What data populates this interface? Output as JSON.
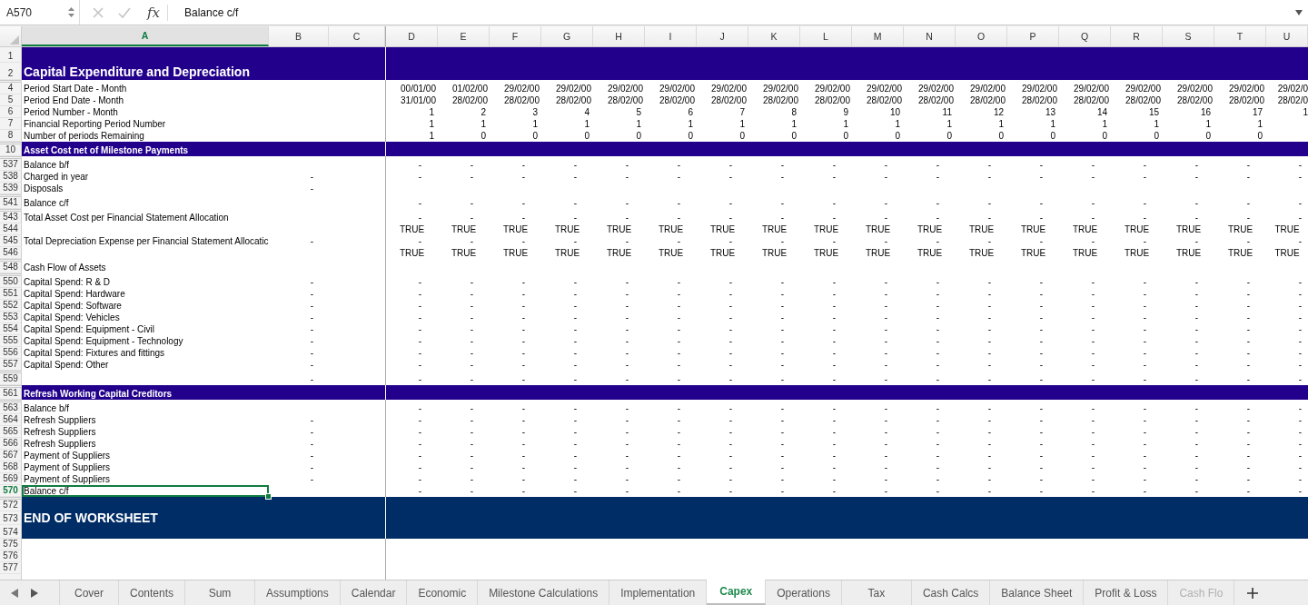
{
  "formula_bar": {
    "name_box": "A570",
    "function_label": "fx",
    "formula": "Balance c/f"
  },
  "columns": [
    {
      "label": "A",
      "selected": true
    },
    {
      "label": "B",
      "selected": false
    },
    {
      "label": "C",
      "selected": false
    },
    {
      "label": "D",
      "selected": false
    },
    {
      "label": "E",
      "selected": false
    },
    {
      "label": "F",
      "selected": false
    },
    {
      "label": "G",
      "selected": false
    },
    {
      "label": "H",
      "selected": false
    },
    {
      "label": "I",
      "selected": false
    },
    {
      "label": "J",
      "selected": false
    },
    {
      "label": "K",
      "selected": false
    },
    {
      "label": "L",
      "selected": false
    },
    {
      "label": "M",
      "selected": false
    },
    {
      "label": "N",
      "selected": false
    },
    {
      "label": "O",
      "selected": false
    },
    {
      "label": "P",
      "selected": false
    },
    {
      "label": "Q",
      "selected": false
    },
    {
      "label": "R",
      "selected": false
    },
    {
      "label": "S",
      "selected": false
    },
    {
      "label": "T",
      "selected": false
    },
    {
      "label": "U",
      "selected": false
    }
  ],
  "rows": [
    {
      "number": "1",
      "kind": "title",
      "selected": false
    },
    {
      "number": "2",
      "kind": "title",
      "label": "Capital Expenditure and Depreciation",
      "selected": false
    },
    {
      "number": "4",
      "kind": "date",
      "label": "Period Start Date - Month",
      "selected": false,
      "values": [
        "00/01/00",
        "01/02/00",
        "29/02/00",
        "29/02/00",
        "29/02/00",
        "29/02/00",
        "29/02/00",
        "29/02/00",
        "29/02/00",
        "29/02/00",
        "29/02/00",
        "29/02/00",
        "29/02/00",
        "29/02/00",
        "29/02/00",
        "29/02/00",
        "29/02/00",
        "29/02/0"
      ]
    },
    {
      "number": "5",
      "kind": "date",
      "label": "Period End Date - Month",
      "selected": false,
      "values": [
        "31/01/00",
        "28/02/00",
        "28/02/00",
        "28/02/00",
        "28/02/00",
        "28/02/00",
        "28/02/00",
        "28/02/00",
        "28/02/00",
        "28/02/00",
        "28/02/00",
        "28/02/00",
        "28/02/00",
        "28/02/00",
        "28/02/00",
        "28/02/00",
        "28/02/00",
        "28/02/0"
      ]
    },
    {
      "number": "6",
      "kind": "number",
      "label": "Period Number - Month",
      "selected": false,
      "values": [
        "1",
        "2",
        "3",
        "4",
        "5",
        "6",
        "7",
        "8",
        "9",
        "10",
        "11",
        "12",
        "13",
        "14",
        "15",
        "16",
        "17",
        "1"
      ]
    },
    {
      "number": "7",
      "kind": "number",
      "label": "Financial Reporting Period Number",
      "selected": false,
      "values": [
        "1",
        "1",
        "1",
        "1",
        "1",
        "1",
        "1",
        "1",
        "1",
        "1",
        "1",
        "1",
        "1",
        "1",
        "1",
        "1",
        "1"
      ]
    },
    {
      "number": "8",
      "kind": "number",
      "label": "Number of periods Remaining",
      "selected": false,
      "values": [
        "1",
        "0",
        "0",
        "0",
        "0",
        "0",
        "0",
        "0",
        "0",
        "0",
        "0",
        "0",
        "0",
        "0",
        "0",
        "0",
        "0"
      ]
    },
    {
      "number": "10",
      "kind": "section",
      "label": "Asset Cost net of Milestone Payments",
      "selected": false
    },
    {
      "number": "537",
      "kind": "accounting",
      "label": "Balance b/f",
      "selected": false,
      "values": [
        "-",
        "-",
        "-",
        "-",
        "-",
        "-",
        "-",
        "-",
        "-",
        "-",
        "-",
        "-",
        "-",
        "-",
        "-",
        "-",
        "-",
        "-"
      ]
    },
    {
      "number": "538",
      "kind": "accounting",
      "label": "Charged in year",
      "column_b": "-",
      "selected": false,
      "values": [
        "-",
        "-",
        "-",
        "-",
        "-",
        "-",
        "-",
        "-",
        "-",
        "-",
        "-",
        "-",
        "-",
        "-",
        "-",
        "-",
        "-",
        "-"
      ]
    },
    {
      "number": "539",
      "kind": "accounting",
      "label": "Disposals",
      "column_b": "-",
      "selected": false
    },
    {
      "number": "541",
      "kind": "accounting",
      "label": "Balance c/f",
      "selected": false,
      "values": [
        "-",
        "-",
        "-",
        "-",
        "-",
        "-",
        "-",
        "-",
        "-",
        "-",
        "-",
        "-",
        "-",
        "-",
        "-",
        "-",
        "-",
        "-"
      ]
    },
    {
      "number": "543",
      "kind": "accounting",
      "label": "Total Asset Cost per Financial Statement Allocation",
      "selected": false,
      "values": [
        "-",
        "-",
        "-",
        "-",
        "-",
        "-",
        "-",
        "-",
        "-",
        "-",
        "-",
        "-",
        "-",
        "-",
        "-",
        "-",
        "-",
        "-"
      ]
    },
    {
      "number": "544",
      "kind": "boolean",
      "selected": false,
      "values": [
        "TRUE",
        "TRUE",
        "TRUE",
        "TRUE",
        "TRUE",
        "TRUE",
        "TRUE",
        "TRUE",
        "TRUE",
        "TRUE",
        "TRUE",
        "TRUE",
        "TRUE",
        "TRUE",
        "TRUE",
        "TRUE",
        "TRUE",
        "TRUE"
      ]
    },
    {
      "number": "545",
      "kind": "accounting",
      "label": "Total Depreciation Expense per Financial Statement Allocatic",
      "column_b": "-",
      "selected": false,
      "values": [
        "-",
        "-",
        "-",
        "-",
        "-",
        "-",
        "-",
        "-",
        "-",
        "-",
        "-",
        "-",
        "-",
        "-",
        "-",
        "-",
        "-",
        "-"
      ]
    },
    {
      "number": "546",
      "kind": "boolean",
      "selected": false,
      "values": [
        "TRUE",
        "TRUE",
        "TRUE",
        "TRUE",
        "TRUE",
        "TRUE",
        "TRUE",
        "TRUE",
        "TRUE",
        "TRUE",
        "TRUE",
        "TRUE",
        "TRUE",
        "TRUE",
        "TRUE",
        "TRUE",
        "TRUE",
        "TRUE"
      ]
    },
    {
      "number": "548",
      "kind": "accounting",
      "label": "Cash Flow of Assets",
      "selected": false
    },
    {
      "number": "550",
      "kind": "accounting",
      "label": "Capital Spend: R & D",
      "column_b": "-",
      "selected": false,
      "values": [
        "-",
        "-",
        "-",
        "-",
        "-",
        "-",
        "-",
        "-",
        "-",
        "-",
        "-",
        "-",
        "-",
        "-",
        "-",
        "-",
        "-",
        "-"
      ]
    },
    {
      "number": "551",
      "kind": "accounting",
      "label": "Capital Spend: Hardware",
      "column_b": "-",
      "selected": false,
      "values": [
        "-",
        "-",
        "-",
        "-",
        "-",
        "-",
        "-",
        "-",
        "-",
        "-",
        "-",
        "-",
        "-",
        "-",
        "-",
        "-",
        "-",
        "-"
      ]
    },
    {
      "number": "552",
      "kind": "accounting",
      "label": "Capital Spend: Software",
      "column_b": "-",
      "selected": false,
      "values": [
        "-",
        "-",
        "-",
        "-",
        "-",
        "-",
        "-",
        "-",
        "-",
        "-",
        "-",
        "-",
        "-",
        "-",
        "-",
        "-",
        "-",
        "-"
      ]
    },
    {
      "number": "553",
      "kind": "accounting",
      "label": "Capital Spend: Vehicles",
      "column_b": "-",
      "selected": false,
      "values": [
        "-",
        "-",
        "-",
        "-",
        "-",
        "-",
        "-",
        "-",
        "-",
        "-",
        "-",
        "-",
        "-",
        "-",
        "-",
        "-",
        "-",
        "-"
      ]
    },
    {
      "number": "554",
      "kind": "accounting",
      "label": "Capital Spend: Equipment - Civil",
      "column_b": "-",
      "selected": false,
      "values": [
        "-",
        "-",
        "-",
        "-",
        "-",
        "-",
        "-",
        "-",
        "-",
        "-",
        "-",
        "-",
        "-",
        "-",
        "-",
        "-",
        "-",
        "-"
      ]
    },
    {
      "number": "555",
      "kind": "accounting",
      "label": "Capital Spend: Equipment - Technology",
      "column_b": "-",
      "selected": false,
      "values": [
        "-",
        "-",
        "-",
        "-",
        "-",
        "-",
        "-",
        "-",
        "-",
        "-",
        "-",
        "-",
        "-",
        "-",
        "-",
        "-",
        "-",
        "-"
      ]
    },
    {
      "number": "556",
      "kind": "accounting",
      "label": "Capital Spend: Fixtures and fittings",
      "column_b": "-",
      "selected": false,
      "values": [
        "-",
        "-",
        "-",
        "-",
        "-",
        "-",
        "-",
        "-",
        "-",
        "-",
        "-",
        "-",
        "-",
        "-",
        "-",
        "-",
        "-",
        "-"
      ]
    },
    {
      "number": "557",
      "kind": "accounting",
      "label": "Capital Spend: Other",
      "column_b": "-",
      "selected": false,
      "values": [
        "-",
        "-",
        "-",
        "-",
        "-",
        "-",
        "-",
        "-",
        "-",
        "-",
        "-",
        "-",
        "-",
        "-",
        "-",
        "-",
        "-",
        "-"
      ]
    },
    {
      "number": "559",
      "kind": "accounting",
      "column_b": "-",
      "selected": false,
      "values": [
        "-",
        "-",
        "-",
        "-",
        "-",
        "-",
        "-",
        "-",
        "-",
        "-",
        "-",
        "-",
        "-",
        "-",
        "-",
        "-",
        "-",
        "-"
      ]
    },
    {
      "number": "561",
      "kind": "section",
      "label": "Refresh Working Capital Creditors",
      "selected": false
    },
    {
      "number": "563",
      "kind": "accounting",
      "label": "Balance b/f",
      "selected": false,
      "values": [
        "-",
        "-",
        "-",
        "-",
        "-",
        "-",
        "-",
        "-",
        "-",
        "-",
        "-",
        "-",
        "-",
        "-",
        "-",
        "-",
        "-",
        "-"
      ]
    },
    {
      "number": "564",
      "kind": "accounting",
      "label": "Refresh Suppliers",
      "column_b": "-",
      "selected": false,
      "values": [
        "-",
        "-",
        "-",
        "-",
        "-",
        "-",
        "-",
        "-",
        "-",
        "-",
        "-",
        "-",
        "-",
        "-",
        "-",
        "-",
        "-",
        "-"
      ]
    },
    {
      "number": "565",
      "kind": "accounting",
      "label": "Refresh Suppliers",
      "column_b": "-",
      "selected": false,
      "values": [
        "-",
        "-",
        "-",
        "-",
        "-",
        "-",
        "-",
        "-",
        "-",
        "-",
        "-",
        "-",
        "-",
        "-",
        "-",
        "-",
        "-",
        "-"
      ]
    },
    {
      "number": "566",
      "kind": "accounting",
      "label": "Refresh Suppliers",
      "column_b": "-",
      "selected": false,
      "values": [
        "-",
        "-",
        "-",
        "-",
        "-",
        "-",
        "-",
        "-",
        "-",
        "-",
        "-",
        "-",
        "-",
        "-",
        "-",
        "-",
        "-",
        "-"
      ]
    },
    {
      "number": "567",
      "kind": "accounting",
      "label": "Payment of Suppliers",
      "column_b": "-",
      "selected": false,
      "values": [
        "-",
        "-",
        "-",
        "-",
        "-",
        "-",
        "-",
        "-",
        "-",
        "-",
        "-",
        "-",
        "-",
        "-",
        "-",
        "-",
        "-",
        "-"
      ]
    },
    {
      "number": "568",
      "kind": "accounting",
      "label": "Payment of Suppliers",
      "column_b": "-",
      "selected": false,
      "values": [
        "-",
        "-",
        "-",
        "-",
        "-",
        "-",
        "-",
        "-",
        "-",
        "-",
        "-",
        "-",
        "-",
        "-",
        "-",
        "-",
        "-",
        "-"
      ]
    },
    {
      "number": "569",
      "kind": "accounting",
      "label": "Payment of Suppliers",
      "column_b": "-",
      "selected": false,
      "values": [
        "-",
        "-",
        "-",
        "-",
        "-",
        "-",
        "-",
        "-",
        "-",
        "-",
        "-",
        "-",
        "-",
        "-",
        "-",
        "-",
        "-",
        "-"
      ]
    },
    {
      "number": "570",
      "kind": "accounting",
      "label": "Balance c/f",
      "selected": true,
      "values": [
        "-",
        "-",
        "-",
        "-",
        "-",
        "-",
        "-",
        "-",
        "-",
        "-",
        "-",
        "-",
        "-",
        "-",
        "-",
        "-",
        "-",
        "-"
      ]
    },
    {
      "number": "572",
      "kind": "end",
      "selected": false
    },
    {
      "number": "573",
      "kind": "end",
      "label": "END OF WORKSHEET",
      "selected": false
    },
    {
      "number": "574",
      "kind": "end",
      "selected": false
    },
    {
      "number": "575",
      "kind": "blank",
      "selected": false
    },
    {
      "number": "576",
      "kind": "blank",
      "selected": false
    },
    {
      "number": "577",
      "kind": "blank",
      "selected": false
    }
  ],
  "tabs": [
    {
      "label": "Cover",
      "selected": false
    },
    {
      "label": "Contents",
      "selected": false
    },
    {
      "label": "Sum",
      "selected": false
    },
    {
      "label": "Assumptions",
      "selected": false
    },
    {
      "label": "Calendar",
      "selected": false
    },
    {
      "label": "Economic",
      "selected": false
    },
    {
      "label": "Milestone Calculations",
      "selected": false
    },
    {
      "label": "Implementation",
      "selected": false
    },
    {
      "label": "Capex",
      "selected": true
    },
    {
      "label": "Operations",
      "selected": false
    },
    {
      "label": "Tax",
      "selected": false
    },
    {
      "label": "Cash Calcs",
      "selected": false
    },
    {
      "label": "Balance Sheet",
      "selected": false
    },
    {
      "label": "Profit & Loss",
      "selected": false
    },
    {
      "label": "Cash Flo",
      "selected": false
    }
  ]
}
